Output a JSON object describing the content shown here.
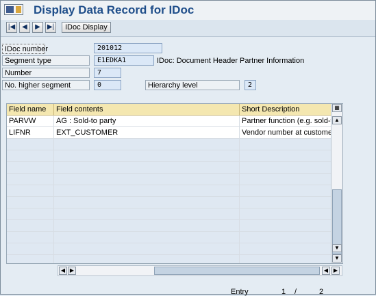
{
  "window": {
    "title": "Display Data Record for IDoc"
  },
  "toolbar": {
    "first_icon": "first-page-icon",
    "prev_icon": "previous-page-icon",
    "next_icon": "next-page-icon",
    "last_icon": "last-page-icon",
    "idoc_display_label": "IDoc Display"
  },
  "header": {
    "idoc_number_label": "IDoc number",
    "idoc_number_value": "201012",
    "segment_type_label": "Segment type",
    "segment_type_value": "E1EDKA1",
    "segment_description": "IDoc: Document Header Partner Information",
    "number_label": "Number",
    "number_value": "7",
    "higher_segment_label": "No. higher segment",
    "higher_segment_value": "0",
    "hierarchy_level_label": "Hierarchy level",
    "hierarchy_level_value": "2"
  },
  "table": {
    "columns": [
      "Field name",
      "Field contents",
      "Short Description"
    ],
    "rows": [
      [
        "PARVW",
        "AG   : Sold-to party",
        "Partner function (e.g. sold-to"
      ],
      [
        "LIFNR",
        "EXT_CUSTOMER",
        "Vendor number at customer"
      ]
    ]
  },
  "footer": {
    "entry_label": "Entry",
    "entry_current": "1",
    "entry_separator": "/",
    "entry_total": "2"
  },
  "colors": {
    "title": "#1f4e8a",
    "table_header": "#f4e7b0",
    "input_fill": "#dbe8f7"
  }
}
